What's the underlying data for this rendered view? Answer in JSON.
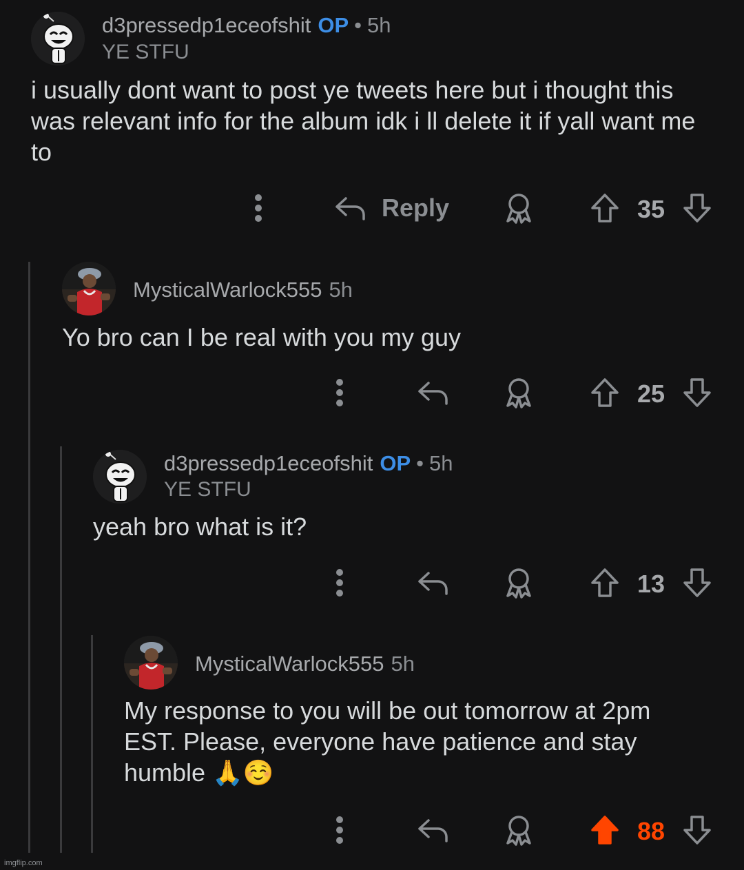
{
  "comments": [
    {
      "username": "d3pressedp1eceofshit",
      "op_badge": "OP",
      "separator": "•",
      "time": "5h",
      "flair": "YE STFU",
      "body": "i usually dont want to post ye tweets here but i thought this was relevant info for the album idk i ll delete it if yall want me to",
      "reply_label": "Reply",
      "score": "35",
      "upvoted": false
    },
    {
      "username": "MysticalWarlock555",
      "time": "5h",
      "body": "Yo bro can I be real with you my guy",
      "score": "25",
      "upvoted": false
    },
    {
      "username": "d3pressedp1eceofshit",
      "op_badge": "OP",
      "separator": "•",
      "time": "5h",
      "flair": "YE STFU",
      "body": "yeah bro what is it?",
      "score": "13",
      "upvoted": false
    },
    {
      "username": "MysticalWarlock555",
      "time": "5h",
      "body": "My response to you will be out tomorrow at 2pm EST. Please, everyone have patience and stay humble 🙏☺️",
      "score": "88",
      "upvoted": true
    }
  ],
  "icons": {
    "more": "more-vertical-icon",
    "reply": "reply-arrow-icon",
    "award": "award-icon",
    "upvote": "upvote-arrow-icon",
    "downvote": "downvote-arrow-icon",
    "avatar_op": "snoo-avatar",
    "avatar_user": "photo-avatar"
  },
  "colors": {
    "background": "#121213",
    "op_badge": "#3d8ee6",
    "upvoted": "#ff4500"
  },
  "watermark": "imgflip.com"
}
